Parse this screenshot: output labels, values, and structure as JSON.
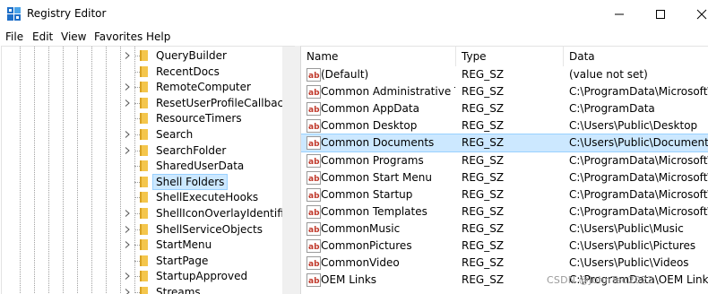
{
  "window": {
    "title": "Registry Editor",
    "icon": "registry-editor-icon",
    "controls": [
      "minimize-icon",
      "maximize-icon",
      "close-icon"
    ]
  },
  "menu": [
    "File",
    "Edit",
    "View",
    "Favorites",
    "Help"
  ],
  "tree": {
    "items": [
      {
        "label": "QueryBuilder",
        "expandable": true
      },
      {
        "label": "RecentDocs",
        "expandable": false
      },
      {
        "label": "RemoteComputer",
        "expandable": true
      },
      {
        "label": "ResetUserProfileCallbacks",
        "expandable": true
      },
      {
        "label": "ResourceTimers",
        "expandable": false
      },
      {
        "label": "Search",
        "expandable": true
      },
      {
        "label": "SearchFolder",
        "expandable": true
      },
      {
        "label": "SharedUserData",
        "expandable": false
      },
      {
        "label": "Shell Folders",
        "expandable": false,
        "selected": true
      },
      {
        "label": "ShellExecuteHooks",
        "expandable": false
      },
      {
        "label": "ShellIconOverlayIdentifiers",
        "expandable": true
      },
      {
        "label": "ShellServiceObjects",
        "expandable": true
      },
      {
        "label": "StartMenu",
        "expandable": true
      },
      {
        "label": "StartPage",
        "expandable": false
      },
      {
        "label": "StartupApproved",
        "expandable": true
      },
      {
        "label": "Streams",
        "expandable": true
      }
    ]
  },
  "list": {
    "columns": {
      "name": "Name",
      "type": "Type",
      "data": "Data"
    },
    "rows": [
      {
        "name": "(Default)",
        "type": "REG_SZ",
        "data": "(value not set)"
      },
      {
        "name": "Common Administrative T...",
        "type": "REG_SZ",
        "data": "C:\\ProgramData\\Microsoft\\W"
      },
      {
        "name": "Common AppData",
        "type": "REG_SZ",
        "data": "C:\\ProgramData"
      },
      {
        "name": "Common Desktop",
        "type": "REG_SZ",
        "data": "C:\\Users\\Public\\Desktop"
      },
      {
        "name": "Common Documents",
        "type": "REG_SZ",
        "data": "C:\\Users\\Public\\Documents",
        "selected": true
      },
      {
        "name": "Common Programs",
        "type": "REG_SZ",
        "data": "C:\\ProgramData\\Microsoft\\W"
      },
      {
        "name": "Common Start Menu",
        "type": "REG_SZ",
        "data": "C:\\ProgramData\\Microsoft\\W"
      },
      {
        "name": "Common Startup",
        "type": "REG_SZ",
        "data": "C:\\ProgramData\\Microsoft\\W"
      },
      {
        "name": "Common Templates",
        "type": "REG_SZ",
        "data": "C:\\ProgramData\\Microsoft\\W"
      },
      {
        "name": "CommonMusic",
        "type": "REG_SZ",
        "data": "C:\\Users\\Public\\Music"
      },
      {
        "name": "CommonPictures",
        "type": "REG_SZ",
        "data": "C:\\Users\\Public\\Pictures"
      },
      {
        "name": "CommonVideo",
        "type": "REG_SZ",
        "data": "C:\\Users\\Public\\Videos"
      },
      {
        "name": "OEM Links",
        "type": "REG_SZ",
        "data": "C:\\ProgramData\\OEM Links"
      }
    ]
  },
  "watermark": "CSDN @JohnTeo2022",
  "colors": {
    "selection": "#cce8ff",
    "selection_border": "#99d1ff",
    "folder": "#f4c64c",
    "accent_blue": "#1e6fc8"
  }
}
